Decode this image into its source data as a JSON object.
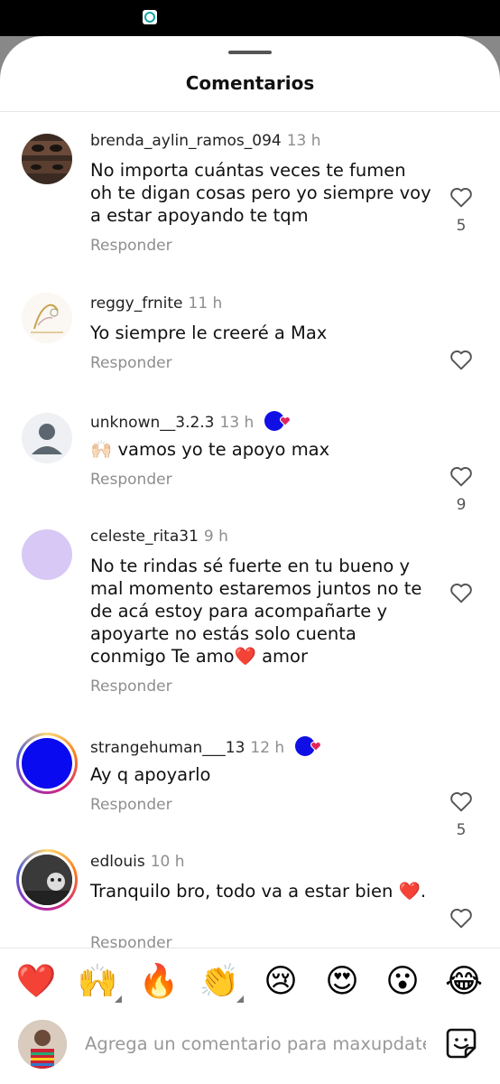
{
  "sheet": {
    "title": "Comentarios"
  },
  "comments": [
    {
      "username": "brenda_aylin_ramos_094",
      "time": "13 h",
      "text": "No importa cuántas veces te fumen oh te digan cosas pero yo siempre voy a estar apoyando te tqm",
      "reply": "Responder",
      "likes": "5",
      "avatar": "photo-eyes"
    },
    {
      "username": "reggy_frnite",
      "time": "11 h",
      "text": "Yo siempre le creeré a Max",
      "reply": "Responder",
      "likes": "",
      "avatar": "sketch-drawing"
    },
    {
      "username": "unknown__3.2.3",
      "time": "13 h",
      "text": "🙌🏻 vamos yo te apoyo max",
      "reply": "Responder",
      "likes": "9",
      "avatar": "default-user"
    },
    {
      "username": "celeste_rita31",
      "time": "9 h",
      "text": "No te rindas sé fuerte en tu bueno y mal momento estaremos juntos no te de acá estoy para acompañarte y apoyarte no estás solo cuenta conmigo Te amo❤️ amor",
      "reply": "Responder",
      "likes": "",
      "avatar": "lavender-circle"
    },
    {
      "username": "strangehuman___13",
      "time": "12 h",
      "text": "Ay q apoyarlo",
      "reply": "Responder",
      "likes": "5",
      "avatar": "blue-circle"
    },
    {
      "username": "edlouis",
      "time": "10 h",
      "text": "Tranquilo bro, todo va a estar bien ❤️.",
      "reply": "Responder",
      "likes": "",
      "avatar": "dark-photo"
    }
  ],
  "reactions": [
    "❤️",
    "🙌",
    "🔥",
    "👏",
    "😢",
    "😍",
    "😮",
    "😂"
  ],
  "composer": {
    "placeholder": "Agrega un comentario para maxupdates"
  },
  "colors": {
    "heart": "#e0245e",
    "badge": "#1010e6",
    "muted": "#8e8e8e"
  }
}
